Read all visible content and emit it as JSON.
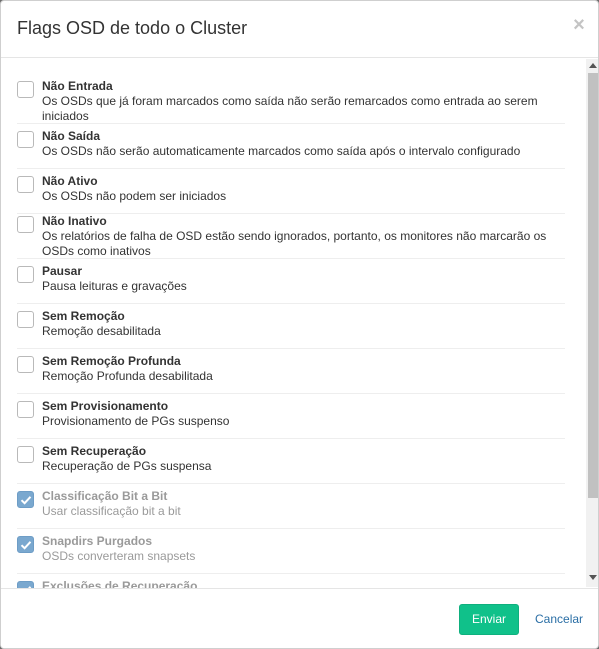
{
  "modal": {
    "title": "Flags OSD de todo o Cluster",
    "close_label": "×"
  },
  "flags": [
    {
      "name": "Não Entrada",
      "desc": "Os OSDs que já foram marcados como saída não serão remarcados como entrada ao serem iniciados",
      "checked": false,
      "disabled": false
    },
    {
      "name": "Não Saída",
      "desc": "Os OSDs não serão automaticamente marcados como saída após o intervalo configurado",
      "checked": false,
      "disabled": false
    },
    {
      "name": "Não Ativo",
      "desc": "Os OSDs não podem ser iniciados",
      "checked": false,
      "disabled": false
    },
    {
      "name": "Não Inativo",
      "desc": "Os relatórios de falha de OSD estão sendo ignorados, portanto, os monitores não marcarão os OSDs como inativos",
      "checked": false,
      "disabled": false
    },
    {
      "name": "Pausar",
      "desc": "Pausa leituras e gravações",
      "checked": false,
      "disabled": false
    },
    {
      "name": "Sem Remoção",
      "desc": "Remoção desabilitada",
      "checked": false,
      "disabled": false
    },
    {
      "name": "Sem Remoção Profunda",
      "desc": "Remoção Profunda desabilitada",
      "checked": false,
      "disabled": false
    },
    {
      "name": "Sem Provisionamento",
      "desc": "Provisionamento de PGs suspenso",
      "checked": false,
      "disabled": false
    },
    {
      "name": "Sem Recuperação",
      "desc": "Recuperação de PGs suspensa",
      "checked": false,
      "disabled": false
    },
    {
      "name": "Classificação Bit a Bit",
      "desc": "Usar classificação bit a bit",
      "checked": true,
      "disabled": true
    },
    {
      "name": "Snapdirs Purgados",
      "desc": "OSDs converteram snapsets",
      "checked": true,
      "disabled": true
    },
    {
      "name": "Exclusões de Recuperação",
      "desc": "",
      "checked": true,
      "disabled": true
    }
  ],
  "footer": {
    "submit_label": "Enviar",
    "cancel_label": "Cancelar"
  },
  "colors": {
    "primary_button": "#10c18a",
    "checkbox_checked": "#7aa8cf",
    "link": "#2a6ea5"
  }
}
